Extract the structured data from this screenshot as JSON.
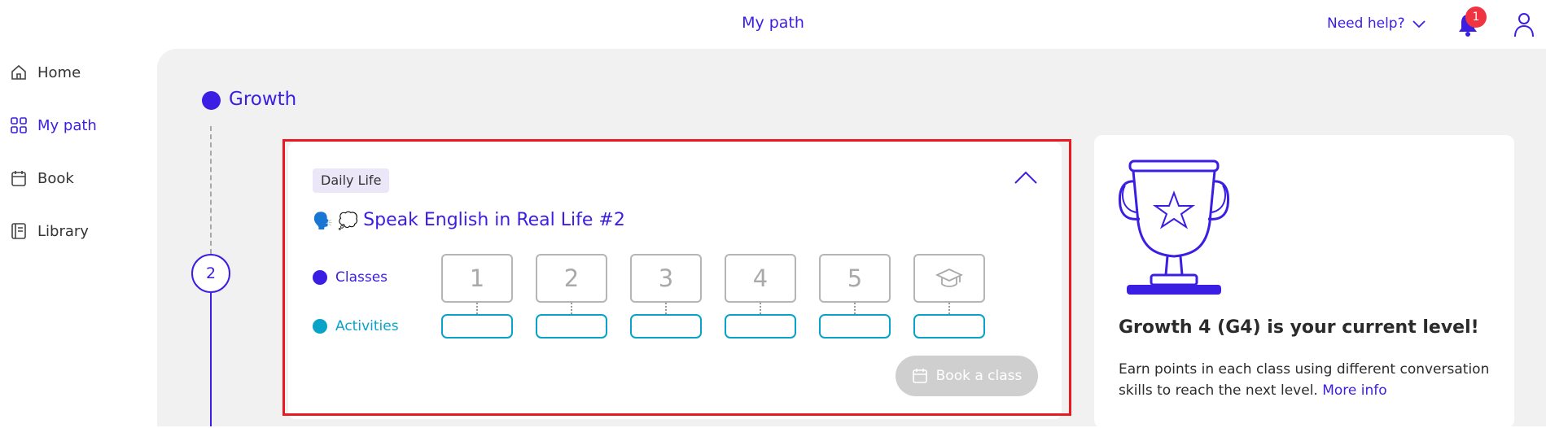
{
  "header": {
    "title": "My path",
    "help_label": "Need help?",
    "notification_count": "1"
  },
  "sidebar": {
    "items": [
      {
        "label": "Home",
        "icon": "home-icon"
      },
      {
        "label": "My path",
        "icon": "grid-icon",
        "active": true
      },
      {
        "label": "Book",
        "icon": "calendar-icon"
      },
      {
        "label": "Library",
        "icon": "book-icon"
      }
    ]
  },
  "path": {
    "stage_title": "Growth",
    "step_number": "2"
  },
  "lesson_card": {
    "tag": "Daily Life",
    "emojis": "🗣️ 💭",
    "title": "Speak English in Real Life #2",
    "legend": {
      "classes_label": "Classes",
      "activities_label": "Activities"
    },
    "classes": [
      "1",
      "2",
      "3",
      "4",
      "5"
    ],
    "final_icon": "graduation-cap-icon",
    "book_button": "Book a class"
  },
  "level_card": {
    "title": "Growth 4 (G4) is your current level!",
    "description": "Earn points in each class using different conversation skills to reach the next level.",
    "link": "More info"
  },
  "colors": {
    "brand": "#3b1ee3",
    "activities": "#09a3c8",
    "badge": "#ef3340",
    "highlight": "#e8191f"
  }
}
